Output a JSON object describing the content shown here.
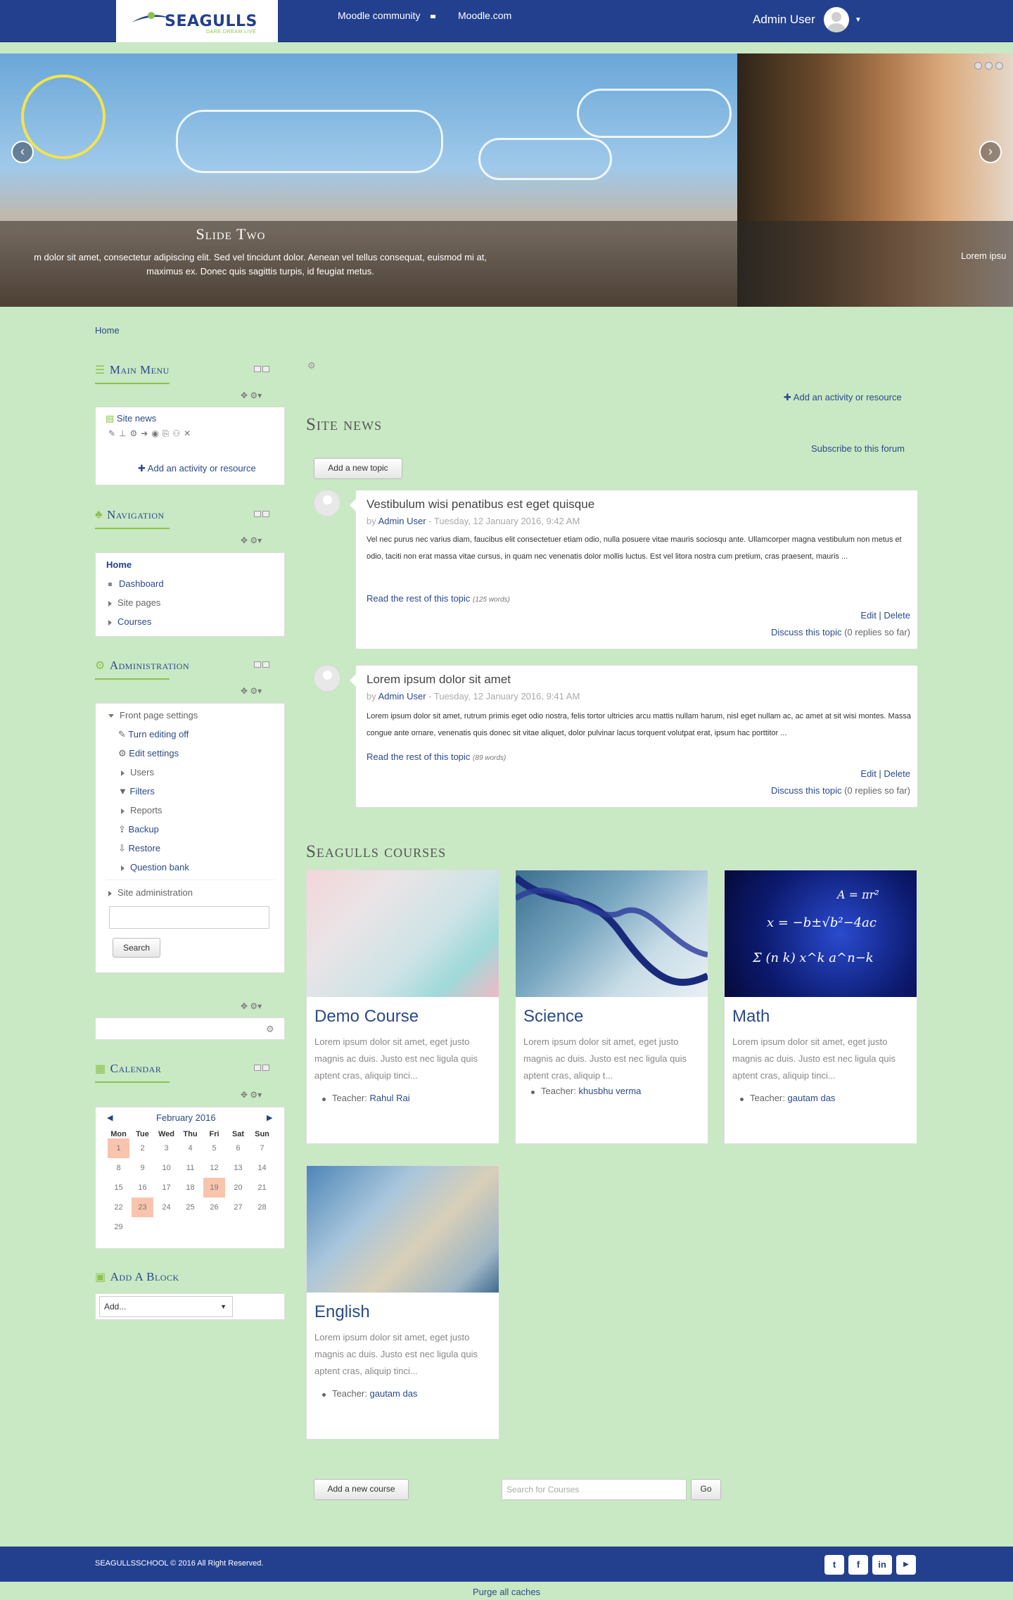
{
  "header": {
    "brand": "SEAGULLS",
    "tagline": "DARE.DREAM.LIVE",
    "nav": [
      "Moodle community",
      "Moodle.com"
    ],
    "user_name": "Admin User"
  },
  "slider": {
    "title": "Slide Two",
    "text_line1": "m dolor sit amet, consectetur adipiscing elit. Sed vel tincidunt dolor. Aenean vel tellus consequat, euismod mi at,",
    "text_line2": "maximus ex. Donec quis sagittis turpis, id feugiat metus.",
    "side_text": "Lorem ipsu"
  },
  "breadcrumb": "Home",
  "main_menu": {
    "title": "Main Menu",
    "item": "Site news",
    "add_activity": "Add an activity or resource"
  },
  "navigation": {
    "title": "Navigation",
    "home": "Home",
    "items": [
      "Dashboard",
      "Site pages",
      "Courses"
    ]
  },
  "administration": {
    "title": "Administration",
    "front_page": "Front page settings",
    "items": [
      "Turn editing off",
      "Edit settings",
      "Users",
      "Filters",
      "Reports",
      "Backup",
      "Restore",
      "Question bank"
    ],
    "site_admin": "Site administration",
    "search_button": "Search"
  },
  "calendar": {
    "title": "Calendar",
    "month": "February 2016",
    "days": [
      "Mon",
      "Tue",
      "Wed",
      "Thu",
      "Fri",
      "Sat",
      "Sun"
    ],
    "weeks": [
      [
        "1",
        "2",
        "3",
        "4",
        "5",
        "6",
        "7"
      ],
      [
        "8",
        "9",
        "10",
        "11",
        "12",
        "13",
        "14"
      ],
      [
        "15",
        "16",
        "17",
        "18",
        "19",
        "20",
        "21"
      ],
      [
        "22",
        "23",
        "24",
        "25",
        "26",
        "27",
        "28"
      ],
      [
        "29",
        "",
        "",
        "",
        "",
        "",
        ""
      ]
    ]
  },
  "add_block": {
    "title": "Add A Block",
    "select_value": "Add..."
  },
  "site_news": {
    "add_activity": "Add an activity or resource",
    "title": "Site news",
    "subscribe": "Subscribe to this forum",
    "add_topic": "Add a new topic",
    "posts": [
      {
        "title": "Vestibulum wisi penatibus est eget quisque",
        "by": "by",
        "author": "Admin User",
        "date": " - Tuesday, 12 January 2016, 9:42 AM",
        "body": " Vel nec purus nec varius diam, faucibus elit consectetuer etiam odio, nulla posuere vitae mauris sociosqu ante. Ullamcorper magna vestibulum non metus et odio, taciti non erat massa vitae cursus, in quam nec venenatis dolor mollis luctus. Est vel litora nostra cum pretium, cras praesent, mauris ...",
        "read_more": "Read the rest of this topic",
        "words": "(125 words)",
        "edit": "Edit",
        "delete": "Delete",
        "discuss": "Discuss this topic",
        "replies": "(0 replies so far)"
      },
      {
        "title": "Lorem ipsum dolor sit amet",
        "by": "by",
        "author": "Admin User",
        "date": " - Tuesday, 12 January 2016, 9:41 AM",
        "body": "Lorem ipsum dolor sit amet, rutrum primis eget odio nostra, felis tortor ultricies arcu mattis nullam harum, nisl eget nullam ac, ac amet at sit wisi montes. Massa congue ante ornare, venenatis quis donec sit vitae aliquet, dolor pulvinar lacus torquent volutpat erat, ipsum hac porttitor ...",
        "read_more": "Read the rest of this topic",
        "words": "(89 words)",
        "edit": "Edit",
        "delete": "Delete",
        "discuss": "Discuss this topic",
        "replies": "(0 replies so far)"
      }
    ]
  },
  "courses": {
    "title": "Seagulls courses",
    "items": [
      {
        "name": "Demo Course",
        "desc": "Lorem ipsum dolor sit amet, eget justo magnis ac duis. Justo est nec ligula quis aptent cras, aliquip tinci...",
        "teacher_label": "Teacher:",
        "teacher": "Rahul Rai"
      },
      {
        "name": "Science",
        "desc": "Lorem ipsum dolor sit amet, eget justo magnis ac duis. Justo est nec ligula quis aptent cras, aliquip t...",
        "teacher_label": "Teacher:",
        "teacher": "khusbhu verma"
      },
      {
        "name": "Math",
        "desc": "Lorem ipsum dolor sit amet, eget justo magnis ac duis. Justo est nec ligula quis aptent cras, aliquip tinci...",
        "teacher_label": "Teacher:",
        "teacher": "gautam das"
      },
      {
        "name": "English",
        "desc": "Lorem ipsum dolor sit amet, eget justo magnis ac duis. Justo est nec ligula quis aptent cras, aliquip tinci...",
        "teacher_label": "Teacher:",
        "teacher": "gautam das"
      }
    ],
    "add_course": "Add a new course",
    "search_placeholder": "Search for Courses",
    "go": "Go"
  },
  "footer": {
    "copyright": "SEAGULLSSCHOOL © 2016 All Right Reserved.",
    "purge": "Purge all caches",
    "social_icons": [
      "twitter-icon",
      "facebook-icon",
      "linkedin-icon",
      "youtube-icon"
    ]
  },
  "colors": {
    "header": "#23408e",
    "background": "#c9e8c4",
    "accent": "#8bc34a",
    "link": "#2a4a8a"
  }
}
